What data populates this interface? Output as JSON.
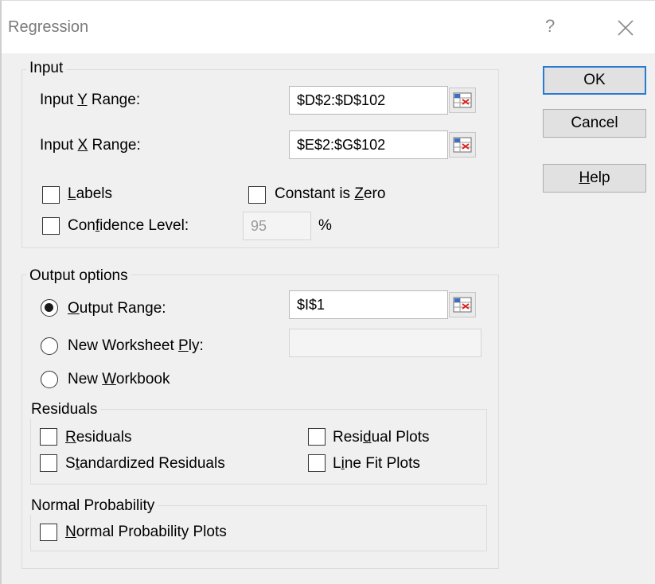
{
  "window": {
    "title": "Regression",
    "help_glyph": "?"
  },
  "input_group": {
    "label": "Input",
    "y_range": {
      "label_pre": "Input ",
      "label_key": "Y",
      "label_post": " Range:",
      "value": "$D$2:$D$102"
    },
    "x_range": {
      "label_pre": "Input ",
      "label_key": "X",
      "label_post": " Range:",
      "value": "$E$2:$G$102"
    },
    "labels_cb": {
      "key": "L",
      "rest": "abels",
      "checked": false
    },
    "constant_zero_cb": {
      "pre": "Constant is ",
      "key": "Z",
      "rest": "ero",
      "checked": false
    },
    "confidence_cb": {
      "pre": "Con",
      "key": "f",
      "rest": "idence Level:",
      "checked": false,
      "value": "95",
      "unit": "%"
    }
  },
  "output_group": {
    "label": "Output options",
    "output_range": {
      "key": "O",
      "rest": "utput Range:",
      "value": "$I$1",
      "selected": true
    },
    "new_ply": {
      "pre": "New Worksheet ",
      "key": "P",
      "rest": "ly:",
      "value": "",
      "selected": false
    },
    "new_workbook": {
      "pre": "New ",
      "key": "W",
      "rest": "orkbook",
      "selected": false
    }
  },
  "residuals_group": {
    "label": "Residuals",
    "residuals": {
      "key": "R",
      "rest": "esiduals",
      "checked": false
    },
    "standardized": {
      "pre": "S",
      "key": "t",
      "rest": "andardized Residuals",
      "checked": false
    },
    "residual_plots": {
      "pre": "Resi",
      "key": "d",
      "rest": "ual Plots",
      "checked": false
    },
    "line_fit": {
      "pre": "L",
      "key": "i",
      "rest": "ne Fit Plots",
      "checked": false
    }
  },
  "normal_group": {
    "label": "Normal Probability",
    "normal_plots": {
      "key": "N",
      "rest": "ormal Probability Plots",
      "checked": false
    }
  },
  "buttons": {
    "ok": "OK",
    "cancel": "Cancel",
    "help_key": "H",
    "help_rest": "elp"
  },
  "icons": {
    "refedit": "range-select-icon",
    "close": "close-icon"
  }
}
